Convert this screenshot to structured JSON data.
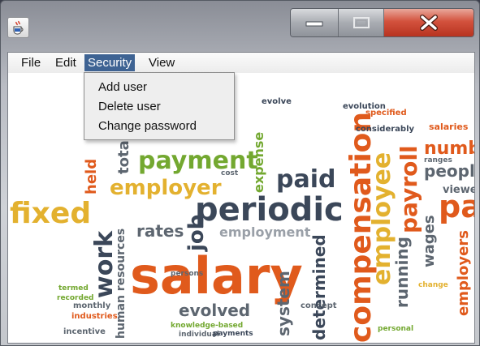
{
  "window": {
    "icon": "java-cup-icon",
    "controls": {
      "minimize": "minimize-icon",
      "maximize": "maximize-icon",
      "close": "close-icon"
    },
    "close_color": "#c8432f"
  },
  "menubar": {
    "items": [
      {
        "label": "File"
      },
      {
        "label": "Edit"
      },
      {
        "label": "Security"
      },
      {
        "label": "View"
      }
    ],
    "active_color": "#3e6393"
  },
  "security_menu": {
    "items": [
      {
        "label": "Add user"
      },
      {
        "label": "Delete user"
      },
      {
        "label": "Change password"
      }
    ]
  },
  "word_cloud": {
    "colors": {
      "orange": "#e05a1c",
      "gray": "#5d6670",
      "green": "#73a830",
      "gold": "#e3b12f",
      "navy": "#3b4759"
    },
    "words": [
      {
        "text": "salary"
      },
      {
        "text": "periodic"
      },
      {
        "text": "payment"
      },
      {
        "text": "employer"
      },
      {
        "text": "paid"
      },
      {
        "text": "fixed"
      },
      {
        "text": "compensation"
      },
      {
        "text": "employee"
      },
      {
        "text": "payroll"
      },
      {
        "text": "pay"
      },
      {
        "text": "number"
      },
      {
        "text": "people"
      },
      {
        "text": "work"
      },
      {
        "text": "job"
      },
      {
        "text": "rates"
      },
      {
        "text": "employment"
      },
      {
        "text": "evolved"
      },
      {
        "text": "system"
      },
      {
        "text": "determined"
      },
      {
        "text": "running"
      },
      {
        "text": "wages"
      },
      {
        "text": "employers"
      },
      {
        "text": "expense"
      },
      {
        "text": "total"
      },
      {
        "text": "held"
      },
      {
        "text": "human resources"
      },
      {
        "text": "viewed"
      },
      {
        "text": "monthly"
      },
      {
        "text": "incentive"
      },
      {
        "text": "concept"
      },
      {
        "text": "industries"
      },
      {
        "text": "salaries"
      },
      {
        "text": "specified"
      },
      {
        "text": "considerably"
      },
      {
        "text": "evolution"
      },
      {
        "text": "evolve"
      },
      {
        "text": "cost"
      },
      {
        "text": "recorded"
      },
      {
        "text": "termed"
      },
      {
        "text": "personal"
      },
      {
        "text": "knowledge-based"
      },
      {
        "text": "individual"
      },
      {
        "text": "payments"
      },
      {
        "text": "change"
      },
      {
        "text": "ranges"
      },
      {
        "text": "persons"
      }
    ]
  }
}
